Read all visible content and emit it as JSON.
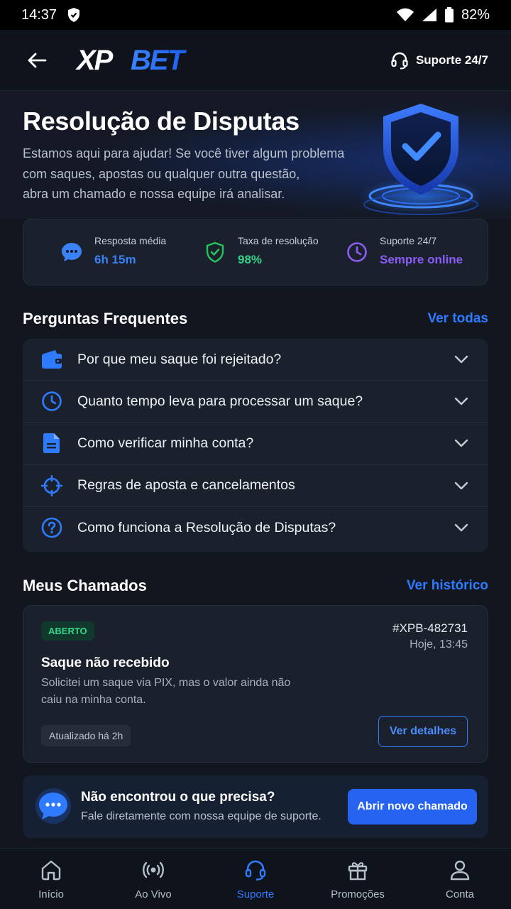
{
  "status_bar": {
    "time": "14:37",
    "battery": "82%"
  },
  "header": {
    "logo_text": "XPBET",
    "support_label": "Suporte 24/7"
  },
  "hero": {
    "title": "Resolução de Disputas",
    "description_lines": [
      "Estamos aqui para ajudar! Se você tiver algum problema",
      "com saques, apostas ou qualquer outra questão,",
      "abra um chamado e nossa equipe irá analisar."
    ]
  },
  "stats": [
    {
      "label": "Resposta média",
      "value": "6h 15m",
      "icon": "chat-icon",
      "color": "#3b82f6"
    },
    {
      "label": "Taxa de resolução",
      "value": "98%",
      "icon": "shield-check-icon",
      "color": "#22c55e"
    },
    {
      "label": "Suporte 24/7",
      "value": "Sempre online",
      "icon": "clock-icon",
      "color": "#8b5cf6"
    }
  ],
  "faq": {
    "title": "Perguntas Frequentes",
    "link": "Ver todas",
    "items": [
      {
        "label": "Por que meu saque foi rejeitado?",
        "icon": "wallet-icon"
      },
      {
        "label": "Quanto tempo leva para processar um saque?",
        "icon": "clock-icon"
      },
      {
        "label": "Como verificar minha conta?",
        "icon": "document-icon"
      },
      {
        "label": "Regras de aposta e cancelamentos",
        "icon": "target-icon"
      },
      {
        "label": "Como funciona a Resolução de Disputas?",
        "icon": "help-circle-icon"
      }
    ]
  },
  "tickets": {
    "title": "Meus Chamados",
    "link": "Ver histórico",
    "item": {
      "status": "ABERTO",
      "id": "#XPB-482731",
      "date": "Hoje, 13:45",
      "title": "Saque não recebido",
      "description_lines": [
        "Solicitei um saque via PIX, mas o valor ainda não",
        "caiu na minha conta."
      ],
      "updated": "Atualizado há 2h",
      "button": "Ver detalhes"
    }
  },
  "cta": {
    "title": "Não encontrou o que precisa?",
    "subtitle": "Fale diretamente com nossa equipe de suporte.",
    "button": "Abrir novo chamado"
  },
  "nav": [
    {
      "label": "Início",
      "icon": "home-icon",
      "active": false
    },
    {
      "label": "Ao Vivo",
      "icon": "live-icon",
      "active": false
    },
    {
      "label": "Suporte",
      "icon": "headset-icon",
      "active": true
    },
    {
      "label": "Promoções",
      "icon": "gift-icon",
      "active": false
    },
    {
      "label": "Conta",
      "icon": "user-icon",
      "active": false
    }
  ],
  "colors": {
    "accent": "#2f7bff",
    "success": "#34d58a",
    "purple": "#8b5cf6"
  }
}
